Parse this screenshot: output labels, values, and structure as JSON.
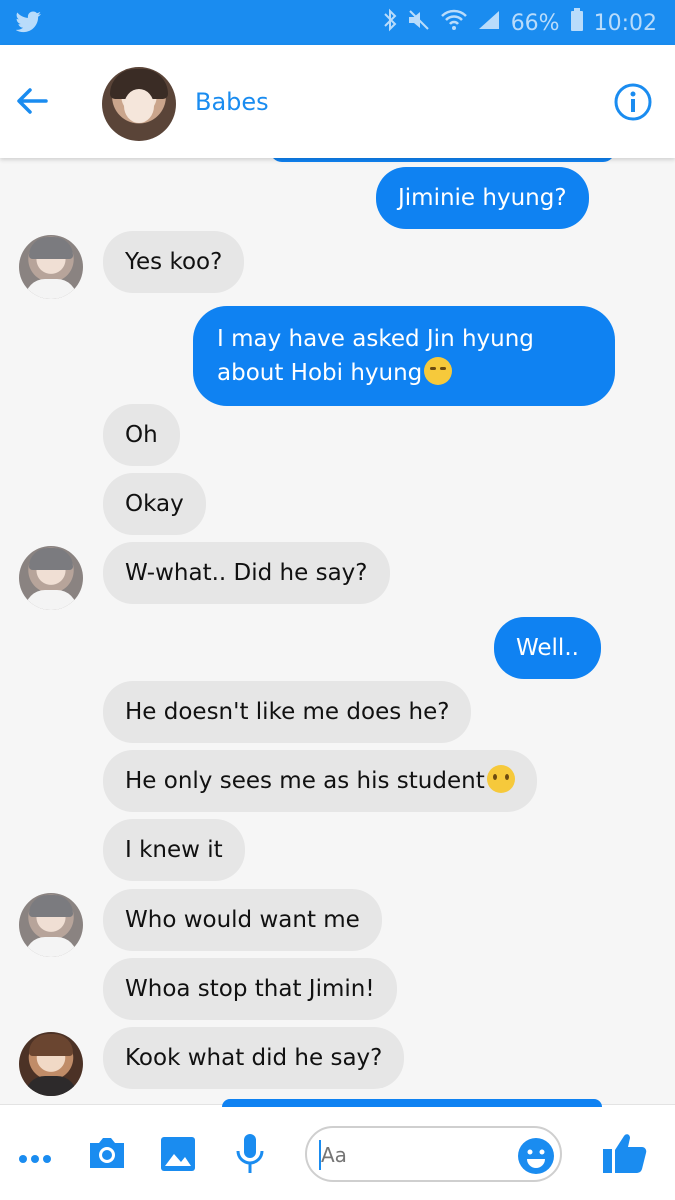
{
  "status_bar": {
    "battery": "66%",
    "time": "10:02"
  },
  "header": {
    "title": "Babes"
  },
  "messages": [
    {
      "type": "sent",
      "text": "Jiminie hyung?"
    },
    {
      "type": "received",
      "text": "Yes koo?"
    },
    {
      "type": "sent",
      "line1": "I may have asked Jin hyung",
      "line2": "about Hobi hyung",
      "emoji": "smirk-emoji"
    },
    {
      "type": "received",
      "text": "Oh"
    },
    {
      "type": "received",
      "text": "Okay"
    },
    {
      "type": "received",
      "text": "W-what.. Did he say?"
    },
    {
      "type": "sent",
      "text": "Well.."
    },
    {
      "type": "received",
      "text": "He doesn't like me does he?"
    },
    {
      "type": "received",
      "text": "He only sees me as his student",
      "emoji": "worried-emoji"
    },
    {
      "type": "received",
      "text": "I knew it"
    },
    {
      "type": "received",
      "text": "Who would want me"
    },
    {
      "type": "received",
      "text": "Whoa stop that Jimin!"
    },
    {
      "type": "received",
      "text": "Kook what did he say?"
    }
  ],
  "composer": {
    "placeholder": "Aa"
  },
  "colors": {
    "accent": "#1a8cf0",
    "sent_bubble": "#0f82f2",
    "received_bubble": "#e6e6e6"
  }
}
